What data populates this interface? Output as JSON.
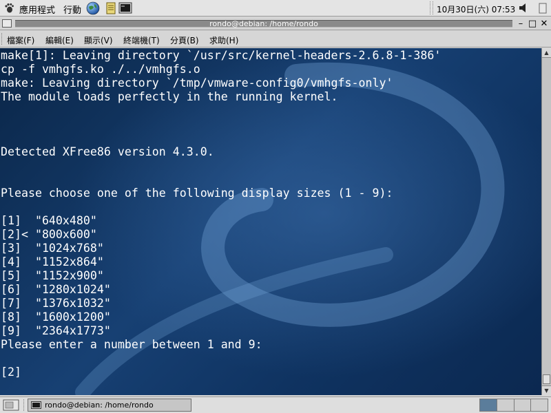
{
  "top_panel": {
    "applications_label": "應用程式",
    "actions_label": "行動",
    "clock": "10月30日(六) 07:53",
    "icons": [
      "foot-icon",
      "web-browser-icon",
      "notes-icon",
      "terminal-icon",
      "volume-icon"
    ]
  },
  "window": {
    "title": "rondo@debian: /home/rondo",
    "buttons": [
      "minimize",
      "maximize",
      "close"
    ]
  },
  "menubar": {
    "items": [
      {
        "label": "檔案(F)"
      },
      {
        "label": "編輯(E)"
      },
      {
        "label": "顯示(V)"
      },
      {
        "label": "終端機(T)"
      },
      {
        "label": "分頁(B)"
      },
      {
        "label": "求助(H)"
      }
    ]
  },
  "terminal": {
    "lines": [
      "make[1]: Leaving directory `/usr/src/kernel-headers-2.6.8-1-386'",
      "cp -f vmhgfs.ko ./../vmhgfs.o",
      "make: Leaving directory `/tmp/vmware-config0/vmhgfs-only'",
      "The module loads perfectly in the running kernel.",
      "",
      "",
      "",
      "Detected XFree86 version 4.3.0.",
      "",
      "",
      "Please choose one of the following display sizes (1 - 9):",
      "",
      "[1]  \"640x480\"",
      "[2]< \"800x600\"",
      "[3]  \"1024x768\"",
      "[4]  \"1152x864\"",
      "[5]  \"1152x900\"",
      "[6]  \"1280x1024\"",
      "[7]  \"1376x1032\"",
      "[8]  \"1600x1200\"",
      "[9]  \"2364x1773\"",
      "Please enter a number between 1 and 9:",
      "",
      "[2] "
    ],
    "colors": {
      "foreground": "#ffffff",
      "background": "#174073"
    }
  },
  "bottom_panel": {
    "task_label": "rondo@debian: /home/rondo",
    "workspaces": 4,
    "active_workspace": 1
  }
}
